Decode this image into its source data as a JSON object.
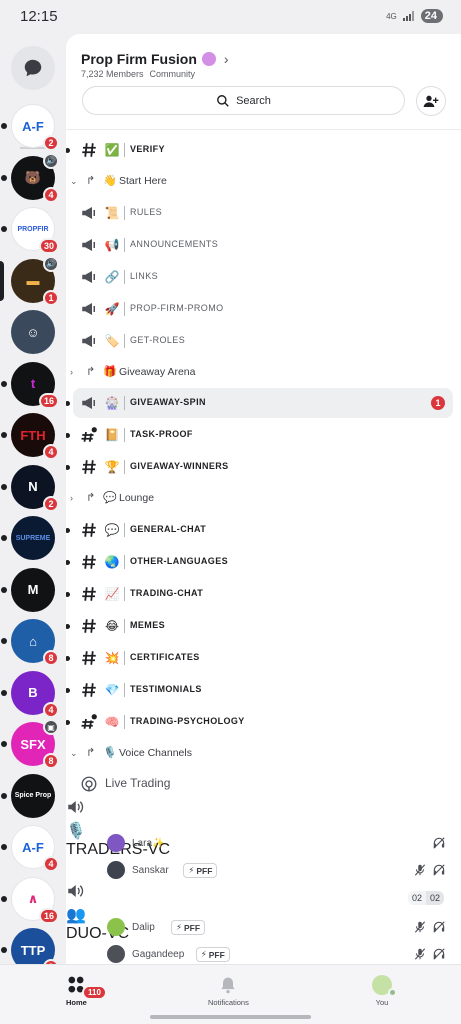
{
  "status": {
    "time": "12:15",
    "network": "4G",
    "battery": "24"
  },
  "server": {
    "name": "Prop Firm Fusion",
    "members": "7,232 Members",
    "type": "Community"
  },
  "search": {
    "label": "Search"
  },
  "rail": [
    {
      "id": "af",
      "label": "A-F",
      "bg": "#ffffff",
      "fg": "#1d63d8",
      "badge": "2",
      "dot": true
    },
    {
      "id": "bear",
      "label": "🐻",
      "bg": "#111214",
      "fg": "#fff",
      "badge": "4",
      "dot": true,
      "voice": true
    },
    {
      "id": "propfi",
      "label": "PROPFIR",
      "bg": "#ffffff",
      "fg": "#2a5bd7",
      "badge": "30",
      "dot": true
    },
    {
      "id": "gold",
      "label": "▬",
      "bg": "#3a2a18",
      "fg": "#f1b24a",
      "badge": "1",
      "selected": true,
      "voice": true
    },
    {
      "id": "face",
      "label": "☺",
      "bg": "#3a4a5c",
      "fg": "#fff",
      "badge": "",
      "dot": false
    },
    {
      "id": "t",
      "label": "t",
      "bg": "#111214",
      "fg": "#c92ad6",
      "badge": "16",
      "dot": true
    },
    {
      "id": "fth",
      "label": "FTH",
      "bg": "#1a0b0b",
      "fg": "#e2232b",
      "badge": "4",
      "dot": true
    },
    {
      "id": "n",
      "label": "N",
      "bg": "#0c1322",
      "fg": "#ffffff",
      "badge": "2",
      "dot": true
    },
    {
      "id": "supreme",
      "label": "SUPREME",
      "bg": "#0b1a33",
      "fg": "#5c8de8",
      "badge": "",
      "dot": true
    },
    {
      "id": "m",
      "label": "M",
      "bg": "#111214",
      "fg": "#ffffff",
      "badge": "",
      "dot": true
    },
    {
      "id": "city",
      "label": "⌂",
      "bg": "#1e5fa8",
      "fg": "#ffffff",
      "badge": "8",
      "dot": true
    },
    {
      "id": "b",
      "label": "B",
      "bg": "#7b25c9",
      "fg": "#ffffff",
      "badge": "4",
      "dot": true
    },
    {
      "id": "sfx",
      "label": "SFX",
      "bg": "#e025b7",
      "fg": "#ffffff",
      "badge": "8",
      "dot": true,
      "extra": true
    },
    {
      "id": "spice",
      "label": "Spice Prop",
      "bg": "#111214",
      "fg": "#ffffff",
      "badge": "",
      "dot": true
    },
    {
      "id": "af2",
      "label": "A-F",
      "bg": "#ffffff",
      "fg": "#1d63d8",
      "badge": "4",
      "dot": true
    },
    {
      "id": "tri",
      "label": "∧",
      "bg": "#ffffff",
      "fg": "#e0247a",
      "badge": "16",
      "dot": true
    },
    {
      "id": "ttp",
      "label": "TTP",
      "bg": "#1b4f9b",
      "fg": "#ffffff",
      "badge": "9",
      "dot": true
    }
  ],
  "channels": [
    {
      "kind": "chan",
      "name": "VERIFY",
      "emoji": "✅",
      "icon": "hash",
      "bold": true,
      "bullet": true
    },
    {
      "kind": "cat",
      "name": "Start Here",
      "emoji": "👋",
      "arrow": "⌄"
    },
    {
      "kind": "chan",
      "name": "RULES",
      "emoji": "📜",
      "icon": "megaphone",
      "bold": false
    },
    {
      "kind": "chan",
      "name": "ANNOUNCEMENTS",
      "emoji": "📢",
      "icon": "megaphone",
      "bold": false
    },
    {
      "kind": "chan",
      "name": "LINKS",
      "emoji": "🔗",
      "icon": "megaphone",
      "bold": false
    },
    {
      "kind": "chan",
      "name": "PROP-FIRM-PROMO",
      "emoji": "🚀",
      "icon": "megaphone",
      "bold": false
    },
    {
      "kind": "chan",
      "name": "GET-ROLES",
      "emoji": "🏷️",
      "icon": "megaphone-thread",
      "bold": false
    },
    {
      "kind": "cat",
      "name": "Giveaway Arena",
      "emoji": "🎁",
      "arrow": "›"
    },
    {
      "kind": "chan",
      "name": "GIVEAWAY-SPIN",
      "emoji": "🎡",
      "icon": "megaphone",
      "bold": true,
      "bullet": true,
      "selected": true,
      "unread": "1"
    },
    {
      "kind": "chan",
      "name": "TASK-PROOF",
      "emoji": "📔",
      "icon": "hash-thread",
      "bold": true,
      "bullet": true
    },
    {
      "kind": "chan",
      "name": "GIVEAWAY-WINNERS",
      "emoji": "🏆",
      "icon": "hash",
      "bold": true,
      "bullet": true
    },
    {
      "kind": "cat",
      "name": "Lounge",
      "emoji": "💬",
      "arrow": "›"
    },
    {
      "kind": "chan",
      "name": "GENERAL-CHAT",
      "emoji": "💬",
      "icon": "hash",
      "bold": true,
      "bullet": true
    },
    {
      "kind": "chan",
      "name": "OTHER-LANGUAGES",
      "emoji": "🌏",
      "icon": "hash",
      "bold": true,
      "bullet": true
    },
    {
      "kind": "chan",
      "name": "TRADING-CHAT",
      "emoji": "📈",
      "icon": "hash",
      "bold": true,
      "bullet": true
    },
    {
      "kind": "chan",
      "name": "MEMES",
      "emoji": "😂",
      "icon": "hash",
      "bold": true,
      "bullet": true
    },
    {
      "kind": "chan",
      "name": "CERTIFICATES",
      "emoji": "💥",
      "icon": "hash",
      "bold": true,
      "bullet": true
    },
    {
      "kind": "chan",
      "name": "TESTIMONIALS",
      "emoji": "💎",
      "icon": "hash",
      "bold": true,
      "bullet": true
    },
    {
      "kind": "chan",
      "name": "TRADING-PSYCHOLOGY",
      "emoji": "🧠",
      "icon": "hash-thread",
      "bold": true,
      "bullet": true
    },
    {
      "kind": "cat",
      "name": "Voice Channels",
      "emoji": "🎙️",
      "arrow": "⌄"
    },
    {
      "kind": "live",
      "name": "Live Trading"
    },
    {
      "kind": "vc",
      "name": "TRADERS-VC",
      "emoji": "🎙️",
      "icon": "speaker"
    },
    {
      "kind": "usr",
      "name": "Lara✨",
      "tag": "",
      "av": "#7e57c2",
      "muted": false
    },
    {
      "kind": "usr",
      "name": "Sanskar",
      "tag": "PFF",
      "av": "#3d4450",
      "muted": true
    },
    {
      "kind": "vc",
      "name": "DUO-VC",
      "emoji": "👥",
      "icon": "speaker",
      "count_a": "02",
      "count_b": "02"
    },
    {
      "kind": "usr",
      "name": "Dalip",
      "tag": "PFF",
      "av": "#8bc34a",
      "muted": true
    },
    {
      "kind": "usr",
      "name": "Gagandeep",
      "tag": "PFF",
      "av": "#4e5058",
      "muted": true
    }
  ],
  "tabs": {
    "home": "Home",
    "home_badge": "110",
    "notifications": "Notifications",
    "you": "You"
  }
}
